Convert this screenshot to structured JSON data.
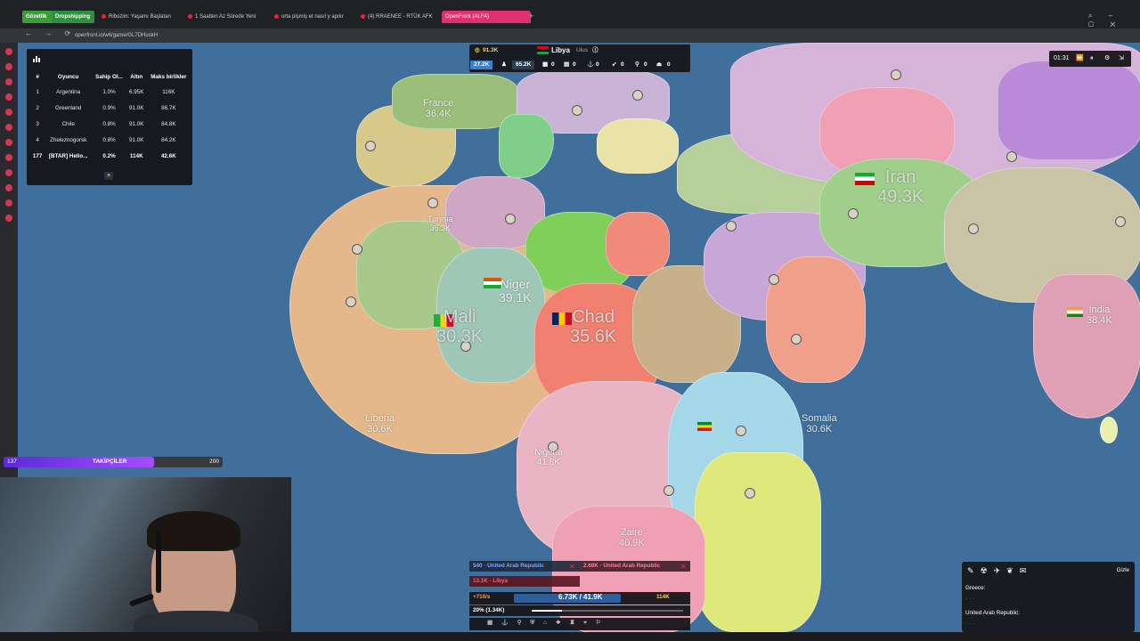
{
  "browser": {
    "tabs": [
      {
        "label": "Gözetlik",
        "color": "#3a9d3a"
      },
      {
        "label": "Dropshipping",
        "color": "#2f8f3f"
      },
      {
        "label": "Ribozim: Yaşamı Başlatan",
        "color": ""
      },
      {
        "label": "1 Saatten Az Sürede Yeni",
        "color": ""
      },
      {
        "label": "orta pişmiş et nasıl y apılır",
        "color": ""
      },
      {
        "label": "(4) RRAENEE - RTÜK AFK",
        "color": ""
      },
      {
        "label": "OpenFront (ALFA)",
        "color": "#e0306e"
      }
    ],
    "url": "openfront.io/w6/game/GL7DHuskH"
  },
  "leaderboard": {
    "headers": [
      "#",
      "Oyuncu",
      "Sahip Ol...",
      "Altın",
      "Maks birlikler"
    ],
    "rows": [
      [
        "1",
        "Argentina",
        "1.0%",
        "6.95K",
        "116K"
      ],
      [
        "2",
        "Greenland",
        "0.9%",
        "91.0K",
        "86.7K"
      ],
      [
        "3",
        "Chile",
        "0.8%",
        "91.0K",
        "84.8K"
      ],
      [
        "4",
        "Zheleznogorsk",
        "0.8%",
        "91.0K",
        "84.2K"
      ],
      [
        "177",
        "[BTAR] Helio...",
        "0.2%",
        "114K",
        "42.6K"
      ]
    ],
    "plus_label": "+"
  },
  "topbar": {
    "gold": "91.3K",
    "country": "Libya",
    "country_type": "Ulus",
    "troops": "27.2K",
    "troops2": "65.2K",
    "stats": [
      "0",
      "0",
      "0",
      "0",
      "0",
      "0"
    ]
  },
  "game_controls": {
    "timer": "01:31"
  },
  "map": {
    "labels": [
      {
        "name": "France",
        "value": "36.4K"
      },
      {
        "name": "Iran",
        "value": "49.3K"
      },
      {
        "name": "Mali",
        "value": "30.3K"
      },
      {
        "name": "Chad",
        "value": "35.6K"
      },
      {
        "name": "Liberia",
        "value": "30.6K"
      },
      {
        "name": "Somalia",
        "value": "30.6K"
      },
      {
        "name": "Zaire",
        "value": "40.9K"
      },
      {
        "name": "India",
        "value": "38.4K"
      },
      {
        "name": "Tunisia",
        "value": "36.3K"
      },
      {
        "name": "Niger",
        "value": "39.1K"
      },
      {
        "name": "Nigeria",
        "value": "41.8K"
      }
    ]
  },
  "followers": {
    "count": "137",
    "label": "TAKİPÇİLER",
    "goal": "200",
    "progress": 0.685
  },
  "bottom_panel": {
    "attack1": "540 · United Arab Republic",
    "attack2": "2.68K · United Arab Republic",
    "incoming": "13.1K · Libya",
    "rate": "+710/s",
    "troops": "6.73K / 41.9K",
    "gold": "114K",
    "ratio": "20% (1.34K)",
    "slider_fraction": 0.2
  },
  "chat": {
    "hide_label": "Gizle",
    "lines": [
      {
        "text": "Greece:",
        "color": "#ffffff"
      },
      {
        "text": "United Arab Republic:",
        "color": "#ffffff"
      }
    ]
  },
  "colors": {
    "ocean": "#3f6f9a",
    "accent": "#e0306e"
  }
}
